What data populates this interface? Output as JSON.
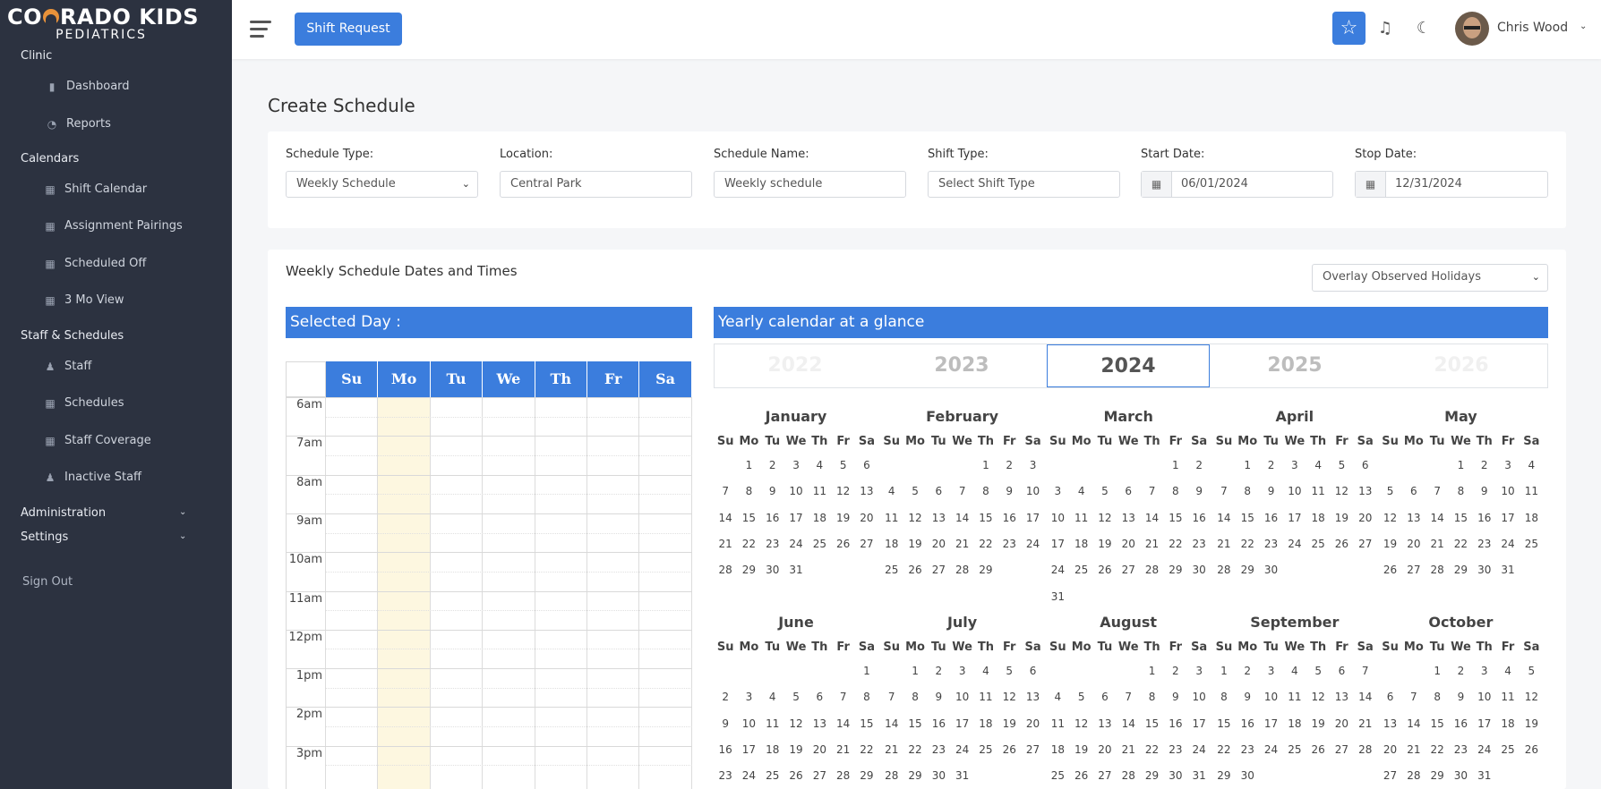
{
  "app": {
    "logo_top": "COLORADO KIDS",
    "logo_bottom": "PEDIATRICS"
  },
  "sidebar": {
    "sections": [
      {
        "label": "Clinic"
      },
      {
        "label": "Calendars"
      },
      {
        "label": "Staff & Schedules"
      },
      {
        "label": "Administration"
      },
      {
        "label": "Settings"
      }
    ],
    "items": [
      {
        "label": "Dashboard",
        "icon": "bar-chart-icon"
      },
      {
        "label": "Reports",
        "icon": "pie-chart-icon"
      },
      {
        "label": "Shift Calendar",
        "icon": "calendar-icon"
      },
      {
        "label": "Assignment Pairings",
        "icon": "calendar-icon"
      },
      {
        "label": "Scheduled Off",
        "icon": "calendar-icon"
      },
      {
        "label": "3 Mo View",
        "icon": "calendar-icon"
      },
      {
        "label": "Staff",
        "icon": "users-icon"
      },
      {
        "label": "Schedules",
        "icon": "calendar-icon"
      },
      {
        "label": "Staff Coverage",
        "icon": "calendar-icon"
      },
      {
        "label": "Inactive Staff",
        "icon": "user-slash-icon"
      }
    ],
    "sign_out": "Sign Out"
  },
  "topbar": {
    "shift_request": "Shift Request",
    "user_name": "Chris Wood"
  },
  "page": {
    "title": "Create Schedule"
  },
  "form": {
    "schedule_type_label": "Schedule Type:",
    "schedule_type_value": "Weekly Schedule",
    "location_label": "Location:",
    "location_value": "Central Park",
    "schedule_name_label": "Schedule Name:",
    "schedule_name_value": "Weekly schedule",
    "shift_type_label": "Shift Type:",
    "shift_type_value": "Select Shift Type",
    "start_date_label": "Start Date:",
    "start_date_value": "06/01/2024",
    "stop_date_label": "Stop Date:",
    "stop_date_value": "12/31/2024"
  },
  "weekly": {
    "title": "Weekly Schedule Dates and Times",
    "holidays_select": "Overlay Observed Holidays",
    "selected_day_header": "Selected Day :",
    "days": [
      "Su",
      "Mo",
      "Tu",
      "We",
      "Th",
      "Fr",
      "Sa"
    ],
    "highlight_day": "Mo",
    "times": [
      "6am",
      "7am",
      "8am",
      "9am",
      "10am",
      "11am",
      "12pm",
      "1pm",
      "2pm",
      "3pm"
    ]
  },
  "yearly": {
    "header": "Yearly calendar at a glance",
    "years": [
      "2022",
      "2023",
      "2024",
      "2025",
      "2026"
    ],
    "selected_year": "2024",
    "dow": [
      "Su",
      "Mo",
      "Tu",
      "We",
      "Th",
      "Fr",
      "Sa"
    ],
    "months": [
      {
        "name": "January",
        "start": 1,
        "days": 31
      },
      {
        "name": "February",
        "start": 4,
        "days": 29
      },
      {
        "name": "March",
        "start": 5,
        "days": 31
      },
      {
        "name": "April",
        "start": 1,
        "days": 30
      },
      {
        "name": "May",
        "start": 3,
        "days": 31
      },
      {
        "name": "June",
        "start": 6,
        "days": 30
      },
      {
        "name": "July",
        "start": 1,
        "days": 31
      },
      {
        "name": "August",
        "start": 4,
        "days": 31
      },
      {
        "name": "September",
        "start": 0,
        "days": 30
      },
      {
        "name": "October",
        "start": 2,
        "days": 31
      }
    ]
  },
  "colors": {
    "accent": "#3b7ddd",
    "sidebar_bg": "#2c3240",
    "highlight_col": "#fdf7e0"
  }
}
